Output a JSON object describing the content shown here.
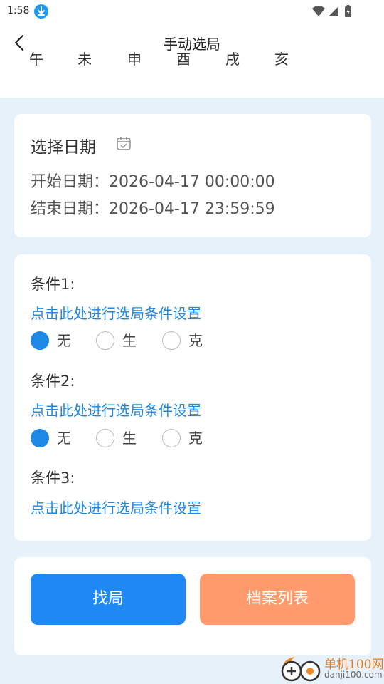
{
  "status_bar": {
    "time": "1:58"
  },
  "header": {
    "title": "手动选局",
    "ganzhi": [
      "午",
      "未",
      "申",
      "酉",
      "戌",
      "亥"
    ]
  },
  "date_card": {
    "title": "选择日期",
    "start_label": "开始日期：",
    "start_value": "2026-04-17 00:00:00",
    "end_label": "结束日期：",
    "end_value": "2026-04-17 23:59:59"
  },
  "conditions": [
    {
      "label": "条件1:",
      "link": "点击此处进行选局条件设置",
      "options": [
        "无",
        "生",
        "克"
      ],
      "selected": "无"
    },
    {
      "label": "条件2:",
      "link": "点击此处进行选局条件设置",
      "options": [
        "无",
        "生",
        "克"
      ],
      "selected": "无"
    },
    {
      "label": "条件3:",
      "link": "点击此处进行选局条件设置"
    }
  ],
  "actions": {
    "find_label": "找局",
    "archive_label": "档案列表"
  },
  "watermark": {
    "name": "单机100网",
    "url": "danji100.com"
  },
  "colors": {
    "accent_blue": "#1e88f5",
    "accent_orange": "#ff9a6c",
    "background": "#e6f1fa"
  }
}
